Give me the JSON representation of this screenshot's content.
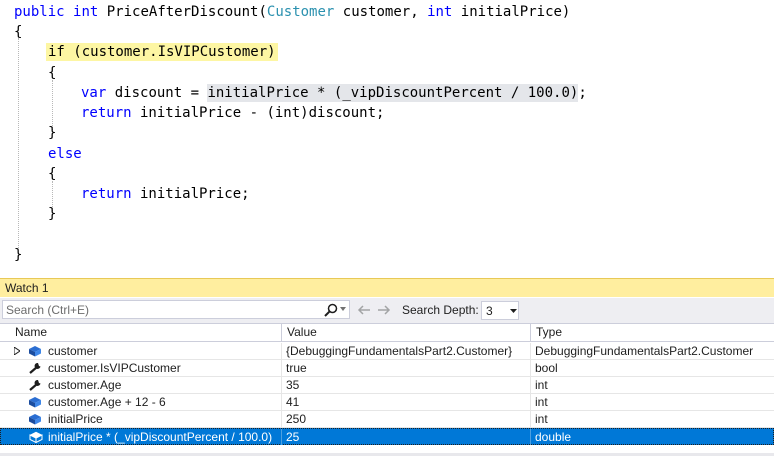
{
  "editor": {
    "line1": {
      "kw1": "public",
      "kw2": "int",
      "method": "PriceAfterDiscount(",
      "type": "Customer",
      "p1": " customer, ",
      "kw3": "int",
      "p2": " initialPrice)"
    },
    "brace_open": "{",
    "if_stmt": "if (customer.IsVIPCustomer)",
    "if_brace_open": "{",
    "var_line": {
      "kw": "var",
      "pre": " discount = ",
      "expr": "initialPrice * (_vipDiscountPercent / 100.0)",
      "post": ";"
    },
    "return1": {
      "kw": "return",
      "rest": " initialPrice - (int)discount;"
    },
    "if_brace_close": "}",
    "else_kw": "else",
    "else_brace_open": "{",
    "return2": {
      "kw": "return",
      "rest": " initialPrice;"
    },
    "else_brace_close": "}",
    "brace_close": "}"
  },
  "watch": {
    "title": "Watch 1",
    "search": {
      "placeholder": "Search (Ctrl+E)",
      "value": ""
    },
    "search_depth_label": "Search Depth:",
    "search_depth_value": "3",
    "columns": {
      "name": "Name",
      "value": "Value",
      "type": "Type"
    },
    "rows": [
      {
        "name": "customer",
        "value": "{DebuggingFundamentalsPart2.Customer}",
        "type": "DebuggingFundamentalsPart2.Customer",
        "icon": "object-icon",
        "expandable": true
      },
      {
        "name": "customer.IsVIPCustomer",
        "value": "true",
        "type": "bool",
        "icon": "wrench-icon"
      },
      {
        "name": "customer.Age",
        "value": "35",
        "type": "int",
        "icon": "wrench-icon"
      },
      {
        "name": "customer.Age + 12 - 6",
        "value": "41",
        "type": "int",
        "icon": "object-icon"
      },
      {
        "name": "initialPrice",
        "value": "250",
        "type": "int",
        "icon": "object-icon"
      },
      {
        "name": "initialPrice * (_vipDiscountPercent / 100.0)",
        "value": "25",
        "type": "double",
        "icon": "object-icon",
        "selected": true
      }
    ]
  },
  "colors": {
    "keyword": "#0000ff",
    "type": "#2b91af",
    "statement_highlight": "#fdf6a3",
    "selection": "#0078d7",
    "watch_title_bg": "#ffee9f"
  }
}
